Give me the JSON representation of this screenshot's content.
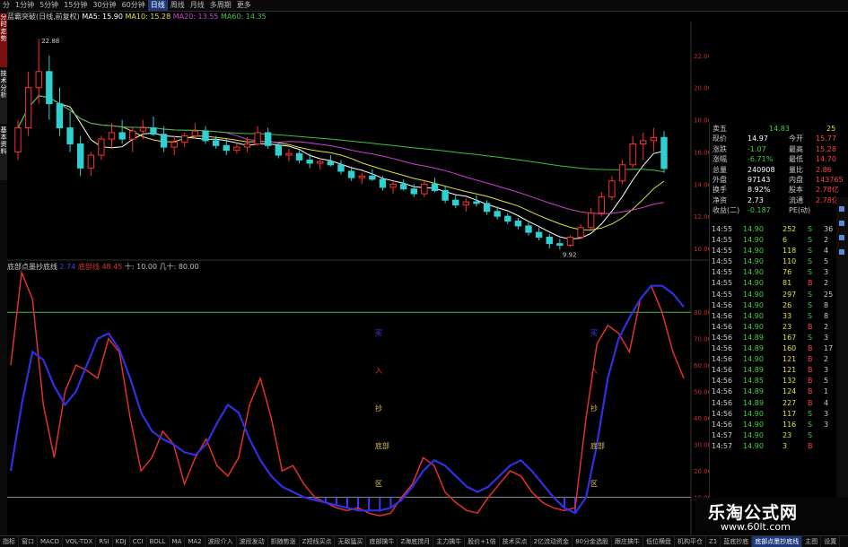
{
  "toolbar": {
    "items": [
      "分",
      "1分钟",
      "5分钟",
      "15分钟",
      "30分钟",
      "60分钟",
      "日线",
      "周线",
      "月线",
      "多周期",
      "更多"
    ],
    "active_index": 6
  },
  "left_strip": [
    "分时走势",
    "技术分析",
    "基本资料"
  ],
  "legend_main": {
    "title": "蓝霸突破(日线,前复权)",
    "ma5": "MA5: 15.90",
    "ma10": "MA10: 15.28",
    "ma20": "MA20: 13.55",
    "ma60": "MA60: 14.35",
    "colors": {
      "ma5": "#ffffff",
      "ma10": "#e0e040",
      "ma20": "#d040d0",
      "ma60": "#40c040",
      "up": "#ff3030",
      "down": "#30d0d0"
    }
  },
  "legend_sub": {
    "title": "底部点墨抄底线",
    "item1": "2.74",
    "item2": "底部线 48.45",
    "item3": "十: 10.00",
    "item4": "几十: 80.00"
  },
  "quote": {
    "sell5": {
      "label": "卖五",
      "price": "14.83",
      "vol": "25"
    },
    "rows": [
      {
        "l1": "现价",
        "v1": "14.97",
        "l2": "今开",
        "v2": "15.77"
      },
      {
        "l1": "涨跌",
        "v1": "-1.07",
        "l2": "最高",
        "v2": "15.28"
      },
      {
        "l1": "涨幅",
        "v1": "-6.71%",
        "l2": "最低",
        "v2": "14.70"
      },
      {
        "l1": "总量",
        "v1": "240908",
        "l2": "量比",
        "v2": "2.86"
      },
      {
        "l1": "外盘",
        "v1": "97143",
        "l2": "内盘",
        "v2": "143765"
      },
      {
        "l1": "换手",
        "v1": "8.92%",
        "l2": "股本",
        "v2": "2.78亿"
      },
      {
        "l1": "净资",
        "v1": "2.73",
        "l2": "流通",
        "v2": "2.78亿"
      },
      {
        "l1": "收益(二)",
        "v1": "-0.187",
        "l2": "PE(动)",
        "v2": ""
      }
    ]
  },
  "trades": [
    [
      "14:55",
      "14.90",
      "252",
      "S",
      "36"
    ],
    [
      "14:55",
      "14.90",
      "6",
      "S",
      "2"
    ],
    [
      "14:55",
      "14.90",
      "118",
      "S",
      "4"
    ],
    [
      "14:55",
      "14.90",
      "110",
      "S",
      "5"
    ],
    [
      "14:55",
      "14.90",
      "76",
      "S",
      "3"
    ],
    [
      "14:55",
      "14.90",
      "81",
      "B",
      "2"
    ],
    [
      "14:55",
      "14.90",
      "297",
      "S",
      "25"
    ],
    [
      "14:56",
      "14.90",
      "26",
      "S",
      "8"
    ],
    [
      "14:56",
      "14.90",
      "33",
      "S",
      "8"
    ],
    [
      "14:56",
      "14.90",
      "23",
      "B",
      "2"
    ],
    [
      "14:56",
      "14.89",
      "167",
      "S",
      "3"
    ],
    [
      "14:56",
      "14.89",
      "160",
      "B",
      "17"
    ],
    [
      "14:56",
      "14.90",
      "121",
      "B",
      "2"
    ],
    [
      "14:56",
      "14.89",
      "121",
      "B",
      "3"
    ],
    [
      "14:56",
      "14.85",
      "132",
      "B",
      "5"
    ],
    [
      "14:56",
      "14.89",
      "124",
      "B",
      "1"
    ],
    [
      "14:56",
      "14.89",
      "227",
      "B",
      "4"
    ],
    [
      "14:56",
      "14.90",
      "117",
      "S",
      "3"
    ],
    [
      "14:56",
      "14.90",
      "116",
      "S",
      "3"
    ],
    [
      "14:57",
      "14.90",
      "23",
      "S",
      ""
    ],
    [
      "14:57",
      "14.90",
      "3",
      "B",
      ""
    ]
  ],
  "bottom_tabs": [
    "指标",
    "窗口",
    "MACD",
    "VOL-TDX",
    "RSI",
    "KDJ",
    "CCI",
    "BOLL",
    "MA",
    "MA2",
    "波段介入",
    "波段发动",
    "抓随势涨",
    "Z短线买点",
    "无敌猛买",
    "底部擒牛",
    "Z海底捞月",
    "主力擒牛",
    "股价+1倍",
    "技术买点",
    "2亿流动资金",
    "80分金选股",
    "跟庄擒牛",
    "低位横盘",
    "机构平仓",
    "Z1",
    "蓝底抄底",
    "底部点墨抄底线",
    "主图",
    "设置"
  ],
  "bottom_active": 27,
  "brand": {
    "cn": "乐淘公式网",
    "url": "www.60lt.com"
  },
  "chart_data": [
    {
      "type": "candlestick",
      "name": "price",
      "annotations": {
        "high": "22.88",
        "low": "9.92"
      },
      "y_axis_ticks": [
        "22.00",
        "20.00",
        "18.00",
        "16.00",
        "14.00",
        "12.00",
        "10.00"
      ],
      "ylim": [
        9.5,
        24
      ],
      "candles": [
        [
          16,
          18,
          15.5,
          17.5
        ],
        [
          17.5,
          21,
          17,
          20
        ],
        [
          20,
          23,
          19,
          21
        ],
        [
          21,
          22,
          18,
          19
        ],
        [
          19,
          20,
          17,
          17.5
        ],
        [
          17.5,
          18.5,
          16,
          16.5
        ],
        [
          16.5,
          17,
          14.5,
          15
        ],
        [
          15,
          16,
          14.5,
          15.8
        ],
        [
          15.8,
          17,
          15.5,
          16.8
        ],
        [
          16.8,
          17.8,
          16.2,
          17.2
        ],
        [
          17.2,
          18,
          16.5,
          16.8
        ],
        [
          16.8,
          17.5,
          16,
          17.3
        ],
        [
          17.3,
          18,
          16.8,
          17.5
        ],
        [
          17.5,
          18.2,
          17,
          17.1
        ],
        [
          17.1,
          17.6,
          16,
          16.3
        ],
        [
          16.3,
          17,
          15.8,
          16.6
        ],
        [
          16.6,
          17.2,
          16.3,
          17
        ],
        [
          17,
          17.8,
          16.8,
          17.3
        ],
        [
          17.3,
          17.6,
          16.5,
          16.7
        ],
        [
          16.7,
          17,
          16.2,
          16.4
        ],
        [
          16.4,
          16.8,
          15.8,
          16.1
        ],
        [
          16.1,
          16.6,
          15.9,
          16.3
        ],
        [
          16.3,
          16.9,
          16,
          16.5
        ],
        [
          16.5,
          17.6,
          16.4,
          17.2
        ],
        [
          17.2,
          17.5,
          16.2,
          16.4
        ],
        [
          16.4,
          16.6,
          15.6,
          15.8
        ],
        [
          15.8,
          16.2,
          15.4,
          15.9
        ],
        [
          15.9,
          16.1,
          15.3,
          15.5
        ],
        [
          15.5,
          15.9,
          15,
          15.3
        ],
        [
          15.3,
          15.6,
          14.9,
          15.4
        ],
        [
          15.4,
          15.8,
          15.1,
          15.2
        ],
        [
          15.2,
          15.5,
          14.6,
          14.8
        ],
        [
          14.8,
          15.1,
          14.2,
          14.4
        ],
        [
          14.4,
          14.7,
          14,
          14.5
        ],
        [
          14.5,
          14.9,
          14.2,
          14.3
        ],
        [
          14.3,
          14.5,
          13.6,
          13.8
        ],
        [
          13.8,
          14.2,
          13.4,
          14
        ],
        [
          14,
          14.3,
          13.6,
          13.7
        ],
        [
          13.7,
          14,
          13.2,
          13.4
        ],
        [
          13.4,
          14.2,
          13.2,
          14
        ],
        [
          14,
          14.4,
          13.5,
          13.6
        ],
        [
          13.6,
          13.9,
          12.8,
          13
        ],
        [
          13,
          13.3,
          12.5,
          12.7
        ],
        [
          12.7,
          13.1,
          12.3,
          12.9
        ],
        [
          12.9,
          13.3,
          12.6,
          12.8
        ],
        [
          12.8,
          13,
          12.1,
          12.3
        ],
        [
          12.3,
          12.6,
          11.8,
          12
        ],
        [
          12,
          12.2,
          11.5,
          11.7
        ],
        [
          11.7,
          11.9,
          11.2,
          11.4
        ],
        [
          11.4,
          11.6,
          10.8,
          11
        ],
        [
          11,
          11.3,
          10.5,
          10.7
        ],
        [
          10.7,
          10.9,
          10,
          10.3
        ],
        [
          10.3,
          10.6,
          9.92,
          10.2
        ],
        [
          10.2,
          10.8,
          10.1,
          10.7
        ],
        [
          10.7,
          11.5,
          10.6,
          11.3
        ],
        [
          11.3,
          12.5,
          11.2,
          12.2
        ],
        [
          12.2,
          13.5,
          12,
          13.2
        ],
        [
          13.2,
          14.5,
          13,
          14.2
        ],
        [
          14.2,
          15.5,
          14,
          15.2
        ],
        [
          15.2,
          17,
          15,
          16.5
        ],
        [
          16.5,
          17.2,
          15.5,
          16.7
        ],
        [
          16.7,
          17.5,
          16,
          16.9
        ],
        [
          16.9,
          17.3,
          14.7,
          14.97
        ]
      ]
    },
    {
      "type": "line",
      "name": "oscillator",
      "y_axis_ticks": [
        "80.00",
        "70.00",
        "60.00",
        "50.00",
        "40.00",
        "30.00",
        "20.00",
        "10.00"
      ],
      "ylim": [
        0,
        95
      ],
      "series": [
        {
          "name": "底部线",
          "color": "#e03030",
          "values": [
            60,
            95,
            85,
            45,
            25,
            50,
            60,
            58,
            55,
            70,
            65,
            40,
            20,
            25,
            35,
            30,
            15,
            25,
            32,
            22,
            18,
            25,
            45,
            55,
            40,
            20,
            22,
            15,
            10,
            8,
            6,
            5,
            6,
            4,
            3,
            4,
            10,
            15,
            25,
            22,
            12,
            8,
            5,
            4,
            10,
            15,
            20,
            18,
            12,
            8,
            6,
            5,
            6,
            40,
            68,
            75,
            72,
            65,
            85,
            90,
            80,
            65,
            55
          ]
        },
        {
          "name": "",
          "color": "#3030e0",
          "values": [
            20,
            45,
            65,
            62,
            52,
            45,
            50,
            60,
            70,
            72,
            66,
            55,
            42,
            35,
            32,
            30,
            27,
            26,
            30,
            38,
            45,
            42,
            32,
            24,
            18,
            14,
            12,
            10,
            9,
            8,
            7,
            6,
            5,
            5,
            5,
            6,
            9,
            14,
            20,
            24,
            22,
            18,
            14,
            12,
            14,
            18,
            22,
            24,
            20,
            15,
            10,
            6,
            4,
            10,
            30,
            55,
            70,
            78,
            85,
            90,
            90,
            87,
            82
          ]
        }
      ],
      "markers": [
        "买",
        "入",
        "抄",
        "底部",
        "区"
      ]
    }
  ]
}
